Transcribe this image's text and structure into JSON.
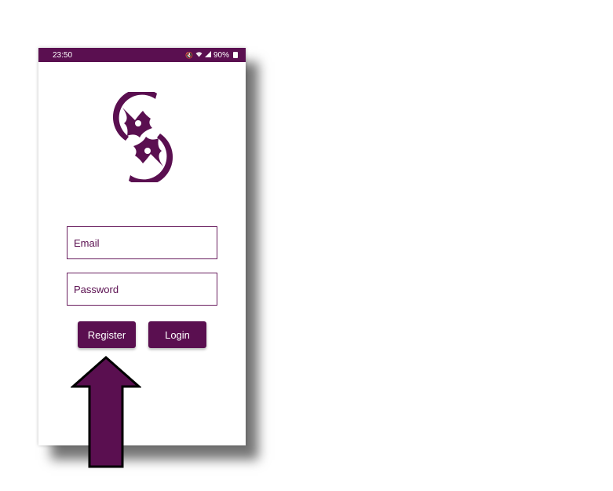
{
  "status_bar": {
    "time": "23:50",
    "icons": [
      "mute-icon",
      "wifi-icon",
      "signal-icon"
    ],
    "battery": "90%"
  },
  "login_form": {
    "email_placeholder": "Email",
    "password_placeholder": "Password",
    "register_label": "Register",
    "login_label": "Login"
  },
  "colors": {
    "brand": "#5a0f50",
    "background": "#ffffff"
  },
  "annotation": {
    "icon": "up-arrow-icon",
    "points_to": "register-button"
  }
}
